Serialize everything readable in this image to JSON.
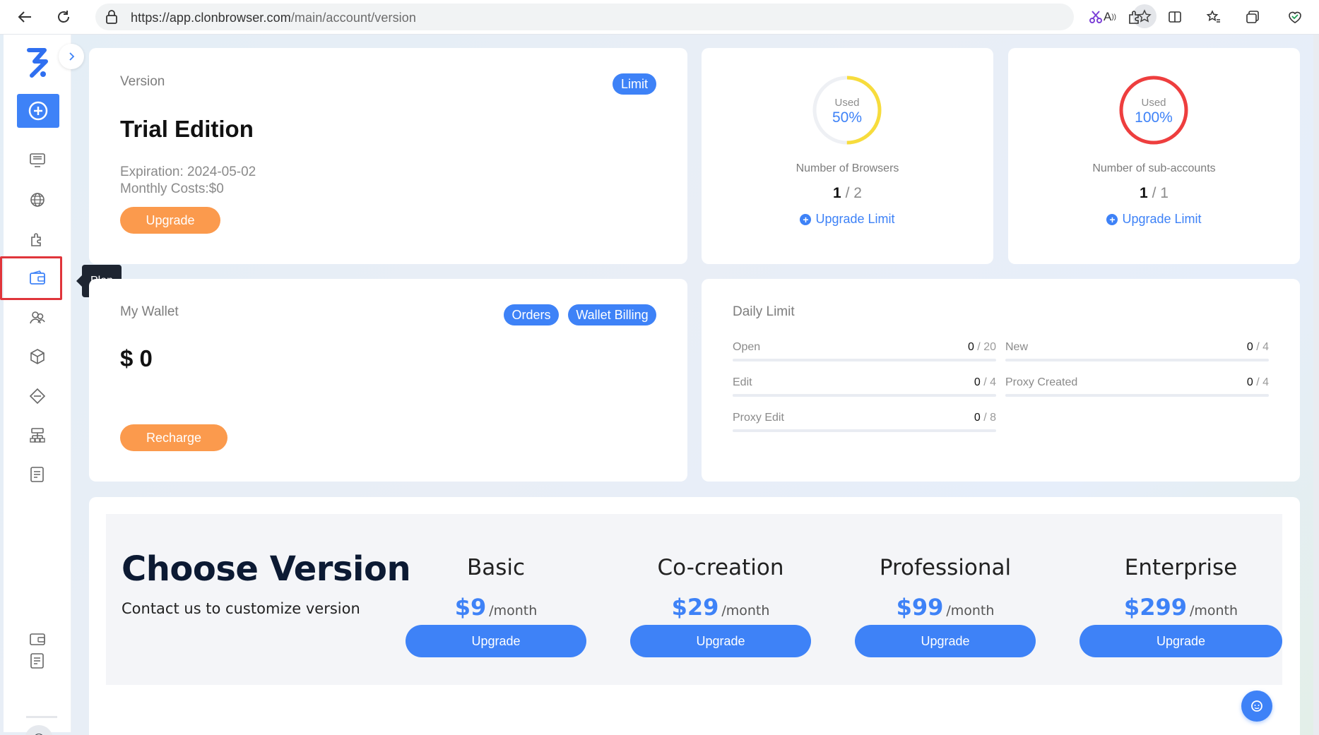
{
  "browser": {
    "url_host": "https://app.clonbrowser.com",
    "url_path": "/main/account/version"
  },
  "sidebar": {
    "tooltip": "Plan"
  },
  "version_card": {
    "title": "Version",
    "limit_label": "Limit",
    "edition": "Trial Edition",
    "expiration": "Expiration: 2024-05-02",
    "monthly_costs": "Monthly Costs:$0",
    "upgrade_label": "Upgrade"
  },
  "browsers_card": {
    "used_label": "Used",
    "used_percent": "50%",
    "used_fraction": 0.5,
    "ring_color": "#f7dc3c",
    "label": "Number of Browsers",
    "used": "1",
    "total": "2",
    "upgrade_link": "Upgrade Limit"
  },
  "subaccounts_card": {
    "used_label": "Used",
    "used_percent": "100%",
    "used_fraction": 1.0,
    "ring_color": "#ee3e3e",
    "label": "Number of sub-accounts",
    "used": "1",
    "total": "1",
    "upgrade_link": "Upgrade Limit"
  },
  "wallet_card": {
    "title": "My Wallet",
    "orders_label": "Orders",
    "billing_label": "Wallet Billing",
    "amount": "$ 0",
    "recharge_label": "Recharge"
  },
  "daily_limit": {
    "title": "Daily Limit",
    "items": [
      {
        "name": "Open",
        "used": "0",
        "total": "20"
      },
      {
        "name": "New",
        "used": "0",
        "total": "4"
      },
      {
        "name": "Edit",
        "used": "0",
        "total": "4"
      },
      {
        "name": "Proxy Created",
        "used": "0",
        "total": "4"
      },
      {
        "name": "Proxy Edit",
        "used": "0",
        "total": "8"
      }
    ]
  },
  "choose_version": {
    "title": "Choose Version",
    "subtitle": "Contact us to customize version",
    "plans": [
      {
        "name": "Basic",
        "price": "$9",
        "period": "/month",
        "button": "Upgrade"
      },
      {
        "name": "Co-creation",
        "price": "$29",
        "period": "/month",
        "button": "Upgrade"
      },
      {
        "name": "Professional",
        "price": "$99",
        "period": "/month",
        "button": "Upgrade"
      },
      {
        "name": "Enterprise",
        "price": "$299",
        "period": "/month",
        "button": "Upgrade"
      }
    ]
  },
  "colors": {
    "primary": "#3e82f7",
    "orange": "#fb9a4d",
    "highlight_red": "#e0353b"
  }
}
